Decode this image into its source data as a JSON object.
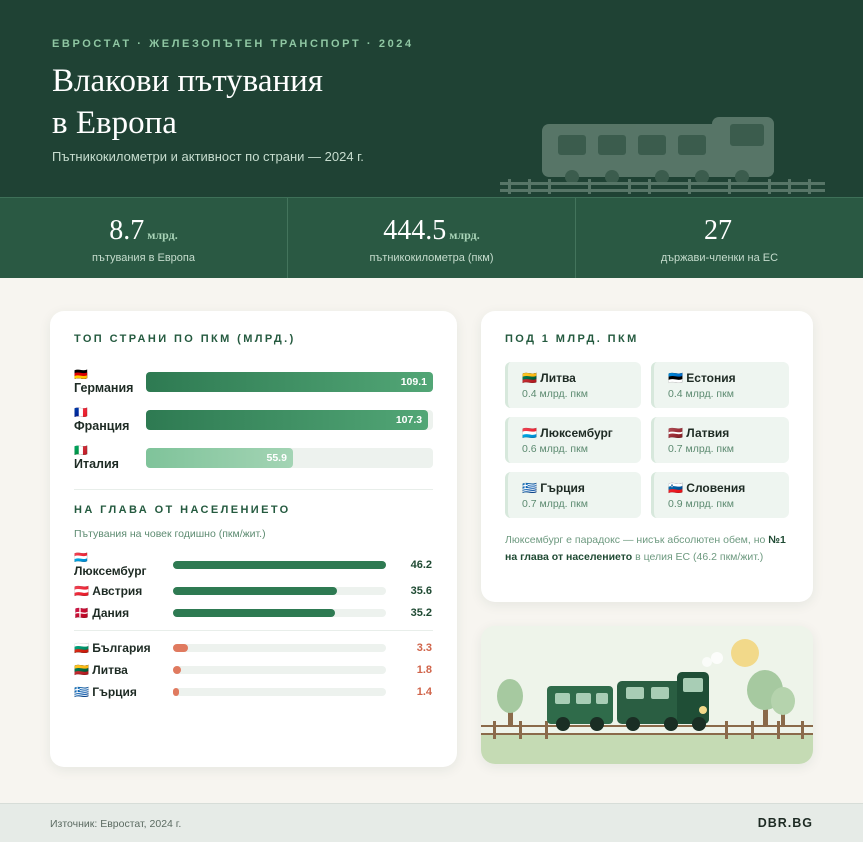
{
  "header": {
    "kicker": "ЕВРОСТАТ · ЖЕЛЕЗОПЪТЕН ТРАНСПОРТ · 2024",
    "title_line1": "Влакови пътувания",
    "title_line2": "в Европа",
    "subtitle": "Пътникокилометри и активност по страни — 2024 г."
  },
  "stats": [
    {
      "value": "8.7",
      "unit": "млрд.",
      "label": "пътувания в Европа"
    },
    {
      "value": "444.5",
      "unit": "млрд.",
      "label": "пътникокилометра (пкм)"
    },
    {
      "value": "27",
      "unit": "",
      "label": "държави-членки на ЕС"
    }
  ],
  "top": {
    "title": "ТОП СТРАНИ ПО ПКМ (МЛРД.)",
    "items": [
      {
        "flag": "🇩🇪",
        "name": "Германия",
        "value": "109.1",
        "fraction": 1.0
      },
      {
        "flag": "🇫🇷",
        "name": "Франция",
        "value": "107.3",
        "fraction": 0.983
      },
      {
        "flag": "🇮🇹",
        "name": "Италия",
        "value": "55.9",
        "fraction": 0.512
      }
    ]
  },
  "per_capita": {
    "title": "НА ГЛАВА ОТ НАСЕЛЕНИЕТО",
    "subtitle": "Пътувания на човек годишно (пкм/жит.)",
    "high": [
      {
        "flag": "🇱🇺",
        "name": "Люксембург",
        "value": "46.2",
        "fraction": 1.0
      },
      {
        "flag": "🇦🇹",
        "name": "Австрия",
        "value": "35.6",
        "fraction": 0.77
      },
      {
        "flag": "🇩🇰",
        "name": "Дания",
        "value": "35.2",
        "fraction": 0.762
      }
    ],
    "low": [
      {
        "flag": "🇧🇬",
        "name": "България",
        "value": "3.3",
        "fraction": 0.071
      },
      {
        "flag": "🇱🇹",
        "name": "Литва",
        "value": "1.8",
        "fraction": 0.039
      },
      {
        "flag": "🇬🇷",
        "name": "Гърция",
        "value": "1.4",
        "fraction": 0.03
      }
    ]
  },
  "small": {
    "title": "ПОД 1 МЛРД. ПКМ",
    "items": [
      {
        "flag": "🇱🇹",
        "name": "Литва",
        "value": "0.4 млрд. пкм"
      },
      {
        "flag": "🇪🇪",
        "name": "Естония",
        "value": "0.4 млрд. пкм"
      },
      {
        "flag": "🇱🇺",
        "name": "Люксембург",
        "value": "0.6 млрд. пкм"
      },
      {
        "flag": "🇱🇻",
        "name": "Латвия",
        "value": "0.7 млрд. пкм"
      },
      {
        "flag": "🇬🇷",
        "name": "Гърция",
        "value": "0.7 млрд. пкм"
      },
      {
        "flag": "🇸🇮",
        "name": "Словения",
        "value": "0.9 млрд. пкм"
      }
    ],
    "note_pre": "Люксембург е парадокс — нисък абсолютен обем, но ",
    "note_bold": "№1 на глава от населението",
    "note_post": " в целия ЕС (46.2 пкм/жит.)"
  },
  "footer": {
    "source": "Източник: Евростат, 2024 г.",
    "brand": "DBR.BG"
  },
  "colors": {
    "dark_green": "#1f4234",
    "band_green": "#2a5943",
    "bar_green": "#2e7a52",
    "low_orange": "#e07a5f",
    "sun": "#f2d98a"
  }
}
